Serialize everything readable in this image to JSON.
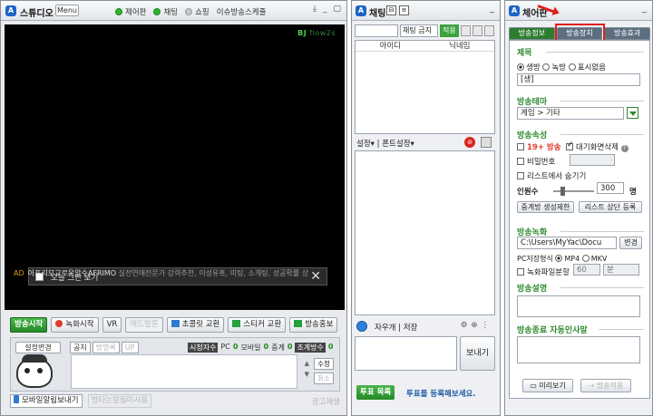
{
  "studio": {
    "title": "스튜디오",
    "menu": "Menu",
    "links": [
      "제어판",
      "채팅",
      "쇼핑",
      "이슈방송스케줄"
    ],
    "bj_label": "BJ",
    "bj_name": "flow2s",
    "notice_text": "오늘 그만 보기",
    "ad_prefix": "AD",
    "ad_brand": "아프리모교로운앙수AFRIMO",
    "ad_text": " 실전연애전문가 강력추천, 이성유혹, 미팅, 소개팅, 성공확률 상",
    "toolbar": {
      "start": "방송시작",
      "record": "녹화시작",
      "vr": "VR",
      "dim": "애드벌룬",
      "choco": "초콜릿 교환",
      "sticker": "스티커 교환",
      "promo": "방송홍보"
    },
    "info": {
      "setting": "설정변경",
      "tabs": [
        "공지",
        "방명록",
        "UP"
      ],
      "viewer_label": "시청자수",
      "pc_label": "PC",
      "pc_val": "0",
      "mobile_label": "모바일",
      "mobile_val": "0",
      "relay_label": "중계",
      "relay_val": "0",
      "relay2_label": "조계방수",
      "relay2_val": "0",
      "edit": "수정",
      "cancel": "취소"
    },
    "bottom": {
      "mobile": "모바일알림보내기",
      "hidden": "방타는알림미시용",
      "right": "광고재생"
    }
  },
  "chat": {
    "title": "채팅",
    "filter": "채팅 금지",
    "apply": "적용",
    "col_id": "아이디",
    "col_nick": "닉네임",
    "settings": "설정",
    "font": "폰트설정",
    "input_label": "자우개 | 저장",
    "send": "보내기",
    "vote_btn": "투표 목록",
    "vote_text": "투표를 등록해보세요."
  },
  "settings": {
    "title": "체어판",
    "tabs": [
      "방송정보",
      "방송장치",
      "방송효과"
    ],
    "title_section": "제목",
    "title_options": [
      "생방",
      "녹방",
      "표시없음"
    ],
    "title_value": "[생]",
    "theme_section": "방송테마",
    "theme_value": "게임 > 기타",
    "attr_section": "방송속성",
    "attr_19": "19+ 방송",
    "attr_waiting": "대기화면삭제",
    "attr_password": "비밀번호",
    "attr_list_hide": "리스트에서 숨기기",
    "viewers_label": "인원수",
    "viewers_value": "300",
    "viewers_unit": "명",
    "relay_limit": "중계방 생성제한",
    "list_top": "리스트 상단 등록",
    "rec_section": "방송녹화",
    "rec_path": "C:\\Users\\MyYac\\Docu",
    "rec_change": "변경",
    "rec_format_label": "PC저장형식",
    "rec_format_options": [
      "MP4",
      "MKV"
    ],
    "rec_split": "녹화파일분할",
    "rec_split_value": "60",
    "rec_split_unit": "분",
    "desc_section": "방송설명",
    "end_section": "방송종료 자동인사말",
    "preview": "미리보기",
    "apply": "방송적용"
  }
}
